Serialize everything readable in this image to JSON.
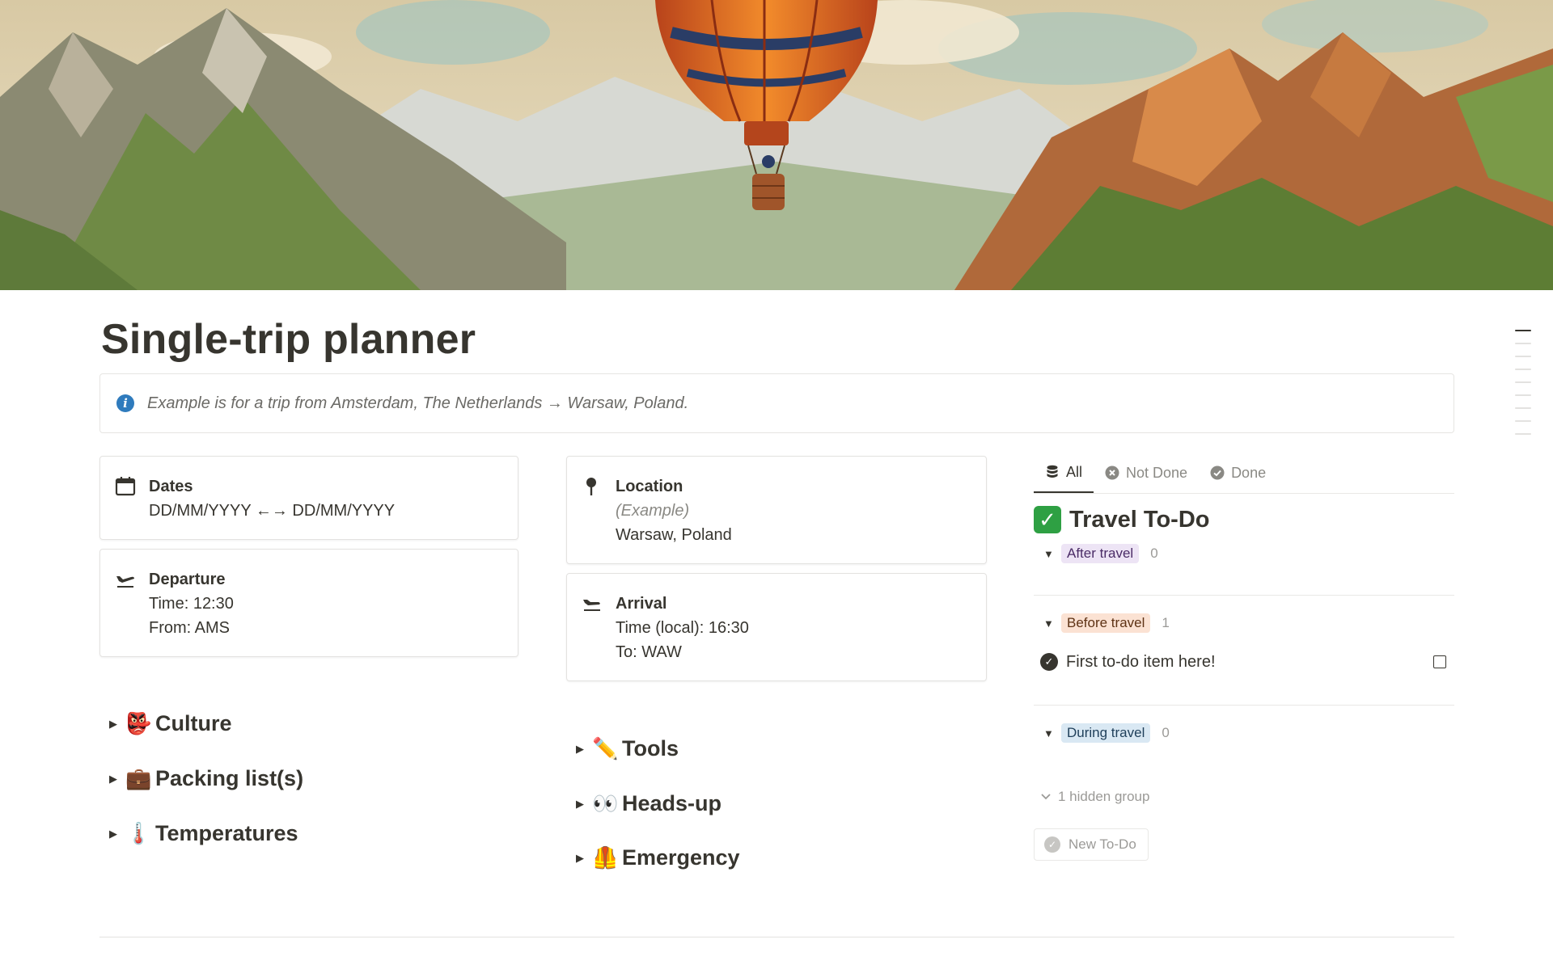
{
  "page": {
    "title": "Single-trip planner",
    "callout": {
      "icon": "info-icon",
      "text": "Example is for a trip from Amsterdam, The Netherlands → Warsaw, Poland."
    }
  },
  "cards": {
    "dates": {
      "icon": "calendar-icon",
      "label": "Dates",
      "value": "DD/MM/YYYY ←→ DD/MM/YYYY"
    },
    "departure": {
      "icon": "plane-departure-icon",
      "label": "Departure",
      "time": "Time: 12:30",
      "from": "From: AMS"
    },
    "location": {
      "icon": "pin-icon",
      "label": "Location",
      "note": "(Example)",
      "value": "Warsaw, Poland"
    },
    "arrival": {
      "icon": "plane-arrival-icon",
      "label": "Arrival",
      "time": "Time (local): 16:30",
      "to": "To: WAW"
    }
  },
  "toggles_left": [
    {
      "emoji": "👺",
      "label": "Culture"
    },
    {
      "emoji": "💼",
      "label": "Packing list(s)"
    },
    {
      "emoji": "🌡️",
      "label": "Temperatures"
    }
  ],
  "toggles_mid": [
    {
      "emoji": "✏️",
      "label": "Tools"
    },
    {
      "emoji": "👀",
      "label": "Heads-up"
    },
    {
      "emoji": "🦺",
      "label": "Emergency"
    }
  ],
  "database": {
    "tabs": [
      {
        "label": "All",
        "icon": "database-icon",
        "active": true
      },
      {
        "label": "Not Done",
        "icon": "x-circle-icon",
        "active": false
      },
      {
        "label": "Done",
        "icon": "check-circle-icon",
        "active": false
      }
    ],
    "title": "Travel To-Do",
    "title_emoji": "✓",
    "groups": [
      {
        "label": "After travel",
        "count": "0",
        "bg": "#ede4f5",
        "fg": "#4a2b66"
      },
      {
        "label": "Before travel",
        "count": "1",
        "bg": "#fbe2d3",
        "fg": "#5e3214",
        "items": [
          {
            "text": "First to-do item here!"
          }
        ]
      },
      {
        "label": "During travel",
        "count": "0",
        "bg": "#d9e8f3",
        "fg": "#1f3f5a"
      }
    ],
    "hidden_group": "1 hidden group",
    "new_button": "New To-Do"
  }
}
